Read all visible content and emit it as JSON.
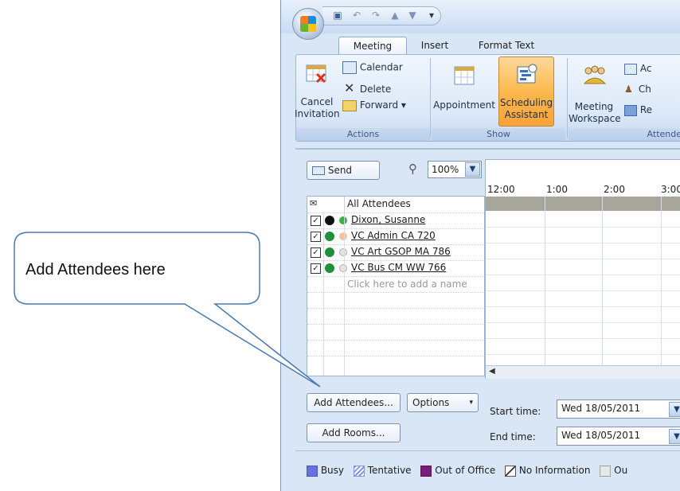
{
  "ribbon": {
    "tabs": [
      "Meeting",
      "Insert",
      "Format Text"
    ],
    "actions": {
      "calendar": "Calendar",
      "delete": "Delete",
      "forward": "Forward",
      "cancel_line1": "Cancel",
      "cancel_line2": "Invitation",
      "group_label": "Actions"
    },
    "show": {
      "appointment": "Appointment",
      "scheduling_line1": "Scheduling",
      "scheduling_line2": "Assistant",
      "group_label": "Show"
    },
    "attendees": {
      "workspace_line1": "Meeting",
      "workspace_line2": "Workspace",
      "ac": "Ac",
      "ch": "Ch",
      "re": "Re",
      "group_label": "Attende"
    }
  },
  "scheduling": {
    "send_label": "Send",
    "zoom_value": "100%",
    "times": [
      "12:00",
      "1:00",
      "2:00",
      "3:00"
    ],
    "all_attendees_label": "All Attendees",
    "attendees": [
      {
        "name": "Dixon, Susanne",
        "checked": true,
        "status_color": "#3cb043",
        "role": "organizer"
      },
      {
        "name": "VC Admin CA 720",
        "checked": true,
        "status_color": "#f3c49b",
        "role": "required"
      },
      {
        "name": "VC Art GSOP MA 786",
        "checked": true,
        "status_color": "#d9d9d9",
        "role": "required"
      },
      {
        "name": "VC Bus CM WW 766",
        "checked": true,
        "status_color": "#d9d9d9",
        "role": "required"
      }
    ],
    "add_name_placeholder": "Click here to add a name",
    "add_attendees_label": "Add Attendees...",
    "options_label": "Options",
    "add_rooms_label": "Add Rooms...",
    "start_time_label": "Start time:",
    "start_date": "Wed 18/05/2011",
    "end_time_label": "End time:",
    "end_date": "Wed 18/05/2011"
  },
  "legend": {
    "busy": "Busy",
    "tentative": "Tentative",
    "out_of_office": "Out of Office",
    "no_information": "No Information",
    "outside": "Ou"
  },
  "callout": {
    "text": "Add Attendees here"
  }
}
